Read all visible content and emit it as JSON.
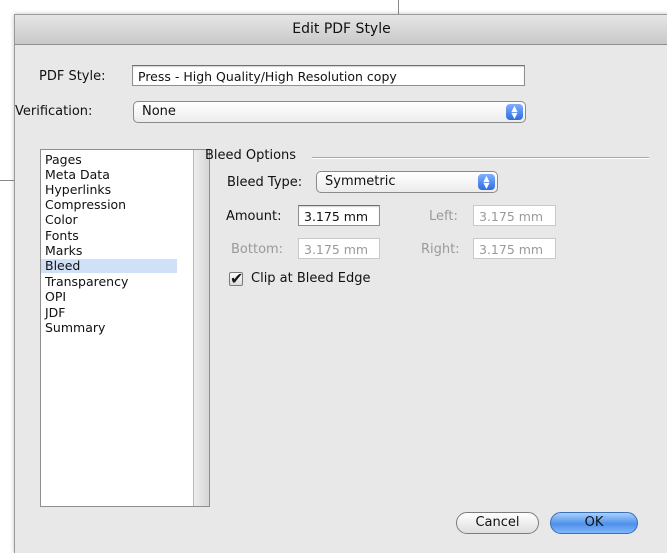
{
  "dialog": {
    "title": "Edit PDF Style"
  },
  "pdf_style": {
    "label": "PDF Style:",
    "value": "Press - High Quality/High Resolution copy"
  },
  "verification": {
    "label": "Verification:",
    "value": "None"
  },
  "sidebar": {
    "items": [
      {
        "label": "Pages",
        "selected": false
      },
      {
        "label": "Meta Data",
        "selected": false
      },
      {
        "label": "Hyperlinks",
        "selected": false
      },
      {
        "label": "Compression",
        "selected": false
      },
      {
        "label": "Color",
        "selected": false
      },
      {
        "label": "Fonts",
        "selected": false
      },
      {
        "label": "Marks",
        "selected": false
      },
      {
        "label": "Bleed",
        "selected": true
      },
      {
        "label": "Transparency",
        "selected": false
      },
      {
        "label": "OPI",
        "selected": false
      },
      {
        "label": "JDF",
        "selected": false
      },
      {
        "label": "Summary",
        "selected": false
      }
    ]
  },
  "bleed": {
    "group_title": "Bleed Options",
    "type_label": "Bleed Type:",
    "type_value": "Symmetric",
    "amount_label": "Amount:",
    "amount_value": "3.175 mm",
    "left_label": "Left:",
    "left_value": "3.175 mm",
    "bottom_label": "Bottom:",
    "bottom_value": "3.175 mm",
    "right_label": "Right:",
    "right_value": "3.175 mm",
    "clip_label": "Clip at Bleed Edge",
    "clip_checked": true
  },
  "buttons": {
    "cancel": "Cancel",
    "ok": "OK"
  },
  "colors": {
    "dialog_bg": "#e8e8e8",
    "selection": "#cfe0f7",
    "default_button": "#4f91e8"
  },
  "icons": {
    "popup_arrows": "updown-arrows-icon",
    "checkmark": "checkmark-icon"
  }
}
